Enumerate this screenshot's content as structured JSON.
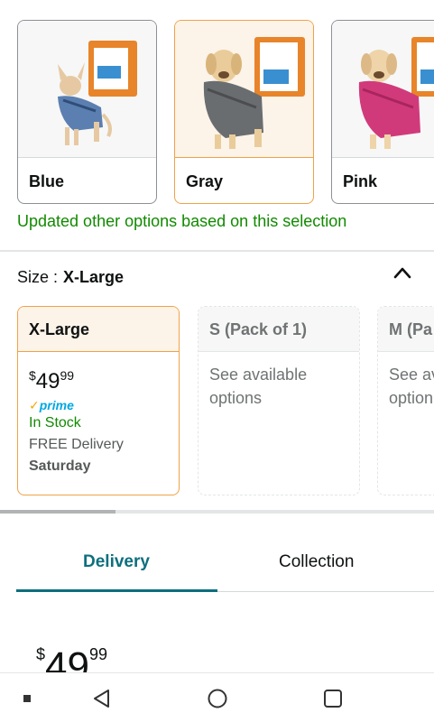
{
  "colors": {
    "accent_orange": "#f0a347",
    "green": "#118a00",
    "teal": "#0d6f7e",
    "prime_blue": "#00a8e1"
  },
  "color_options": [
    {
      "label": "Blue",
      "selected": false
    },
    {
      "label": "Gray",
      "selected": true
    },
    {
      "label": "Pink",
      "selected": false
    }
  ],
  "updated_message": "Updated other options based on this selection",
  "size": {
    "label": "Size :",
    "value": "X-Large",
    "toggle_icon": "chevron-up-icon"
  },
  "size_options": [
    {
      "name": "X-Large",
      "selected": true,
      "price_currency": "$",
      "price_whole": "49",
      "price_cents": "99",
      "prime_check": "✓",
      "prime_label": "prime",
      "stock": "In Stock",
      "delivery": "FREE Delivery",
      "delivery_day": "Saturday"
    },
    {
      "name": "S (Pack of 1)",
      "selected": false,
      "note": "See available options"
    },
    {
      "name": "M (Pa",
      "selected": false,
      "note": "See av option"
    }
  ],
  "tabs": [
    {
      "label": "Delivery",
      "active": true
    },
    {
      "label": "Collection",
      "active": false
    }
  ],
  "price": {
    "currency": "$",
    "whole": "49",
    "cents": "99"
  },
  "navbar": {
    "icons": [
      "square-dot-icon",
      "back-triangle-icon",
      "home-circle-icon",
      "recents-square-icon"
    ]
  }
}
